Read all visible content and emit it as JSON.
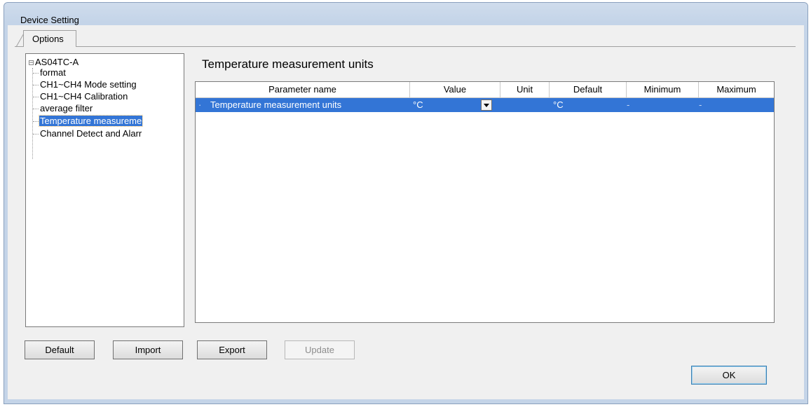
{
  "window": {
    "title": "Device Setting"
  },
  "tabs": [
    {
      "label": "Options"
    }
  ],
  "tree": {
    "root": "AS04TC-A",
    "items": [
      {
        "label": "format"
      },
      {
        "label": "CH1~CH4 Mode setting"
      },
      {
        "label": "CH1~CH4 Calibration"
      },
      {
        "label": "average filter"
      },
      {
        "label": "Temperature measureme"
      },
      {
        "label": "Channel Detect and Alarr"
      }
    ],
    "selected_index": 4
  },
  "main": {
    "heading": "Temperature measurement units",
    "columns": [
      "Parameter name",
      "Value",
      "Unit",
      "Default",
      "Minimum",
      "Maximum"
    ],
    "rows": [
      {
        "name": "Temperature measurement units",
        "value": "°C",
        "unit": "",
        "default": "°C",
        "minimum": "-",
        "maximum": "-"
      }
    ]
  },
  "buttons": {
    "default": "Default",
    "import": "Import",
    "export": "Export",
    "update": "Update",
    "ok": "OK"
  }
}
